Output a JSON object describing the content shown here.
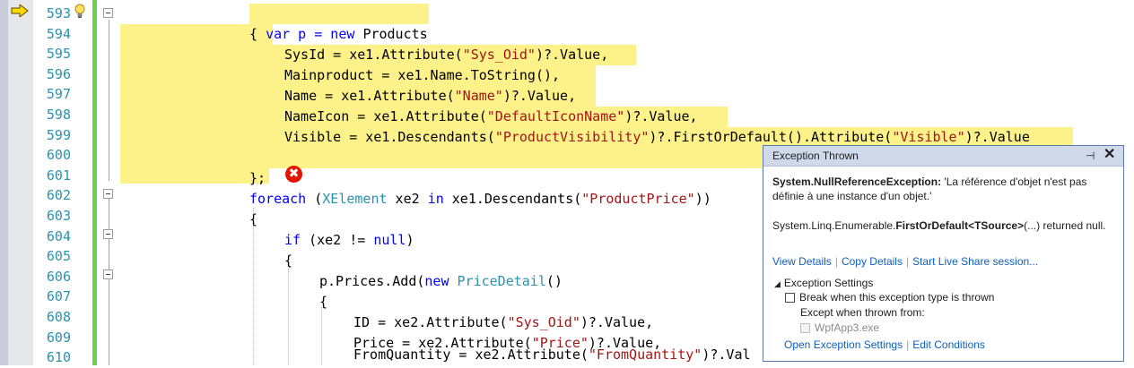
{
  "editor": {
    "lines": [
      {
        "num": "593",
        "segs": [
          {
            "t": "var p = new ",
            "c": "hl"
          },
          {
            "t": "Products",
            "c": "hl"
          },
          {
            "t": " ",
            "c": "hl"
          }
        ]
      },
      {
        "num": "594",
        "segs": [
          {
            "t": "{",
            "c": ""
          }
        ]
      },
      {
        "num": "595",
        "segs": [
          {
            "t": "    SysId = xe1.Attribute(\"Sys_Oid\")?.Value,",
            "c": ""
          }
        ]
      },
      {
        "num": "596",
        "segs": [
          {
            "t": "    Mainproduct = xe1.Name.ToString(),",
            "c": ""
          }
        ]
      },
      {
        "num": "597",
        "segs": [
          {
            "t": "    Name = xe1.Attribute(\"Name\")?.Value,",
            "c": ""
          }
        ]
      },
      {
        "num": "598",
        "segs": [
          {
            "t": "    NameIcon = xe1.Attribute(\"DefaultIconName\")?.Value,",
            "c": ""
          }
        ]
      },
      {
        "num": "599",
        "segs": [
          {
            "t": "    Visible = xe1.Descendants(\"ProductVisibility\")?.FirstOrDefault().Attribute(\"Visible\")?.Value",
            "c": ""
          }
        ]
      },
      {
        "num": "600",
        "segs": []
      },
      {
        "num": "601",
        "segs": [
          {
            "t": "};",
            "c": ""
          }
        ]
      },
      {
        "num": "602",
        "segs": []
      },
      {
        "num": "603",
        "segs": []
      },
      {
        "num": "604",
        "segs": []
      },
      {
        "num": "605",
        "segs": []
      },
      {
        "num": "606",
        "segs": []
      },
      {
        "num": "607",
        "segs": []
      },
      {
        "num": "608",
        "segs": []
      },
      {
        "num": "609",
        "segs": []
      },
      {
        "num": "610",
        "segs": []
      }
    ],
    "code": {
      "l593a": "var p = new ",
      "l593b": "Products",
      "l594": "{",
      "l595a": "SysId = xe1.Attribute(",
      "l595s": "\"Sys_Oid\"",
      "l595b": ")?.Value,",
      "l596": "Mainproduct = xe1.Name.ToString(),",
      "l597a": "Name = xe1.Attribute(",
      "l597s": "\"Name\"",
      "l597b": ")?.Value,",
      "l598a": "NameIcon = xe1.Attribute(",
      "l598s": "\"DefaultIconName\"",
      "l598b": ")?.Value,",
      "l599a": "Visible = xe1.Descendants(",
      "l599s": "\"ProductVisibility\"",
      "l599b": ")?.FirstOrDefault().Attribute(",
      "l599s2": "\"Visible\"",
      "l599c": ")?.Value",
      "l601": "};",
      "l602kw": "foreach",
      "l602a": " (",
      "l602ty": "XElement",
      "l602b": " xe2 ",
      "l602in": "in",
      "l602c": " xe1.Descendants(",
      "l602s": "\"ProductPrice\"",
      "l602d": "))",
      "l603": "{",
      "l604kw": "if",
      "l604a": " (xe2 != ",
      "l604null": "null",
      "l604b": ")",
      "l605": "{",
      "l606a": "p.Prices.Add(",
      "l606kw": "new",
      "l606sp": " ",
      "l606ty": "PriceDetail",
      "l606b": "()",
      "l607": "{",
      "l608a": "ID = xe2.Attribute(",
      "l608s": "\"Sys_Oid\"",
      "l608b": ")?.Value,",
      "l609a": "Price = xe2.Attribute(",
      "l609s": "\"Price\"",
      "l609b": ")?.Value,",
      "l610a": "FromQuantity = xe2.Attribute(",
      "l610s": "\"FromQuantity\"",
      "l610b": ")?.Val"
    },
    "error_glyph": "✖"
  },
  "exception_popup": {
    "title": "Exception Thrown",
    "pin_glyph": "⊣",
    "close_glyph": "✕",
    "exception_type": "System.NullReferenceException:",
    "message": " 'La référence d'objet n'est pas définie à une instance d'un objet.'",
    "detail_prefix": "System.Linq.Enumerable.",
    "detail_bold": "FirstOrDefault<TSource>",
    "detail_suffix": "(...) returned null.",
    "links": [
      "View Details",
      "Copy Details",
      "Start Live Share session..."
    ],
    "settings_header": "Exception Settings",
    "break_label": "Break when this exception type is thrown",
    "except_label": "Except when thrown from:",
    "app_label": "WpfApp3.exe",
    "footer_links": [
      "Open Exception Settings",
      "Edit Conditions"
    ]
  }
}
